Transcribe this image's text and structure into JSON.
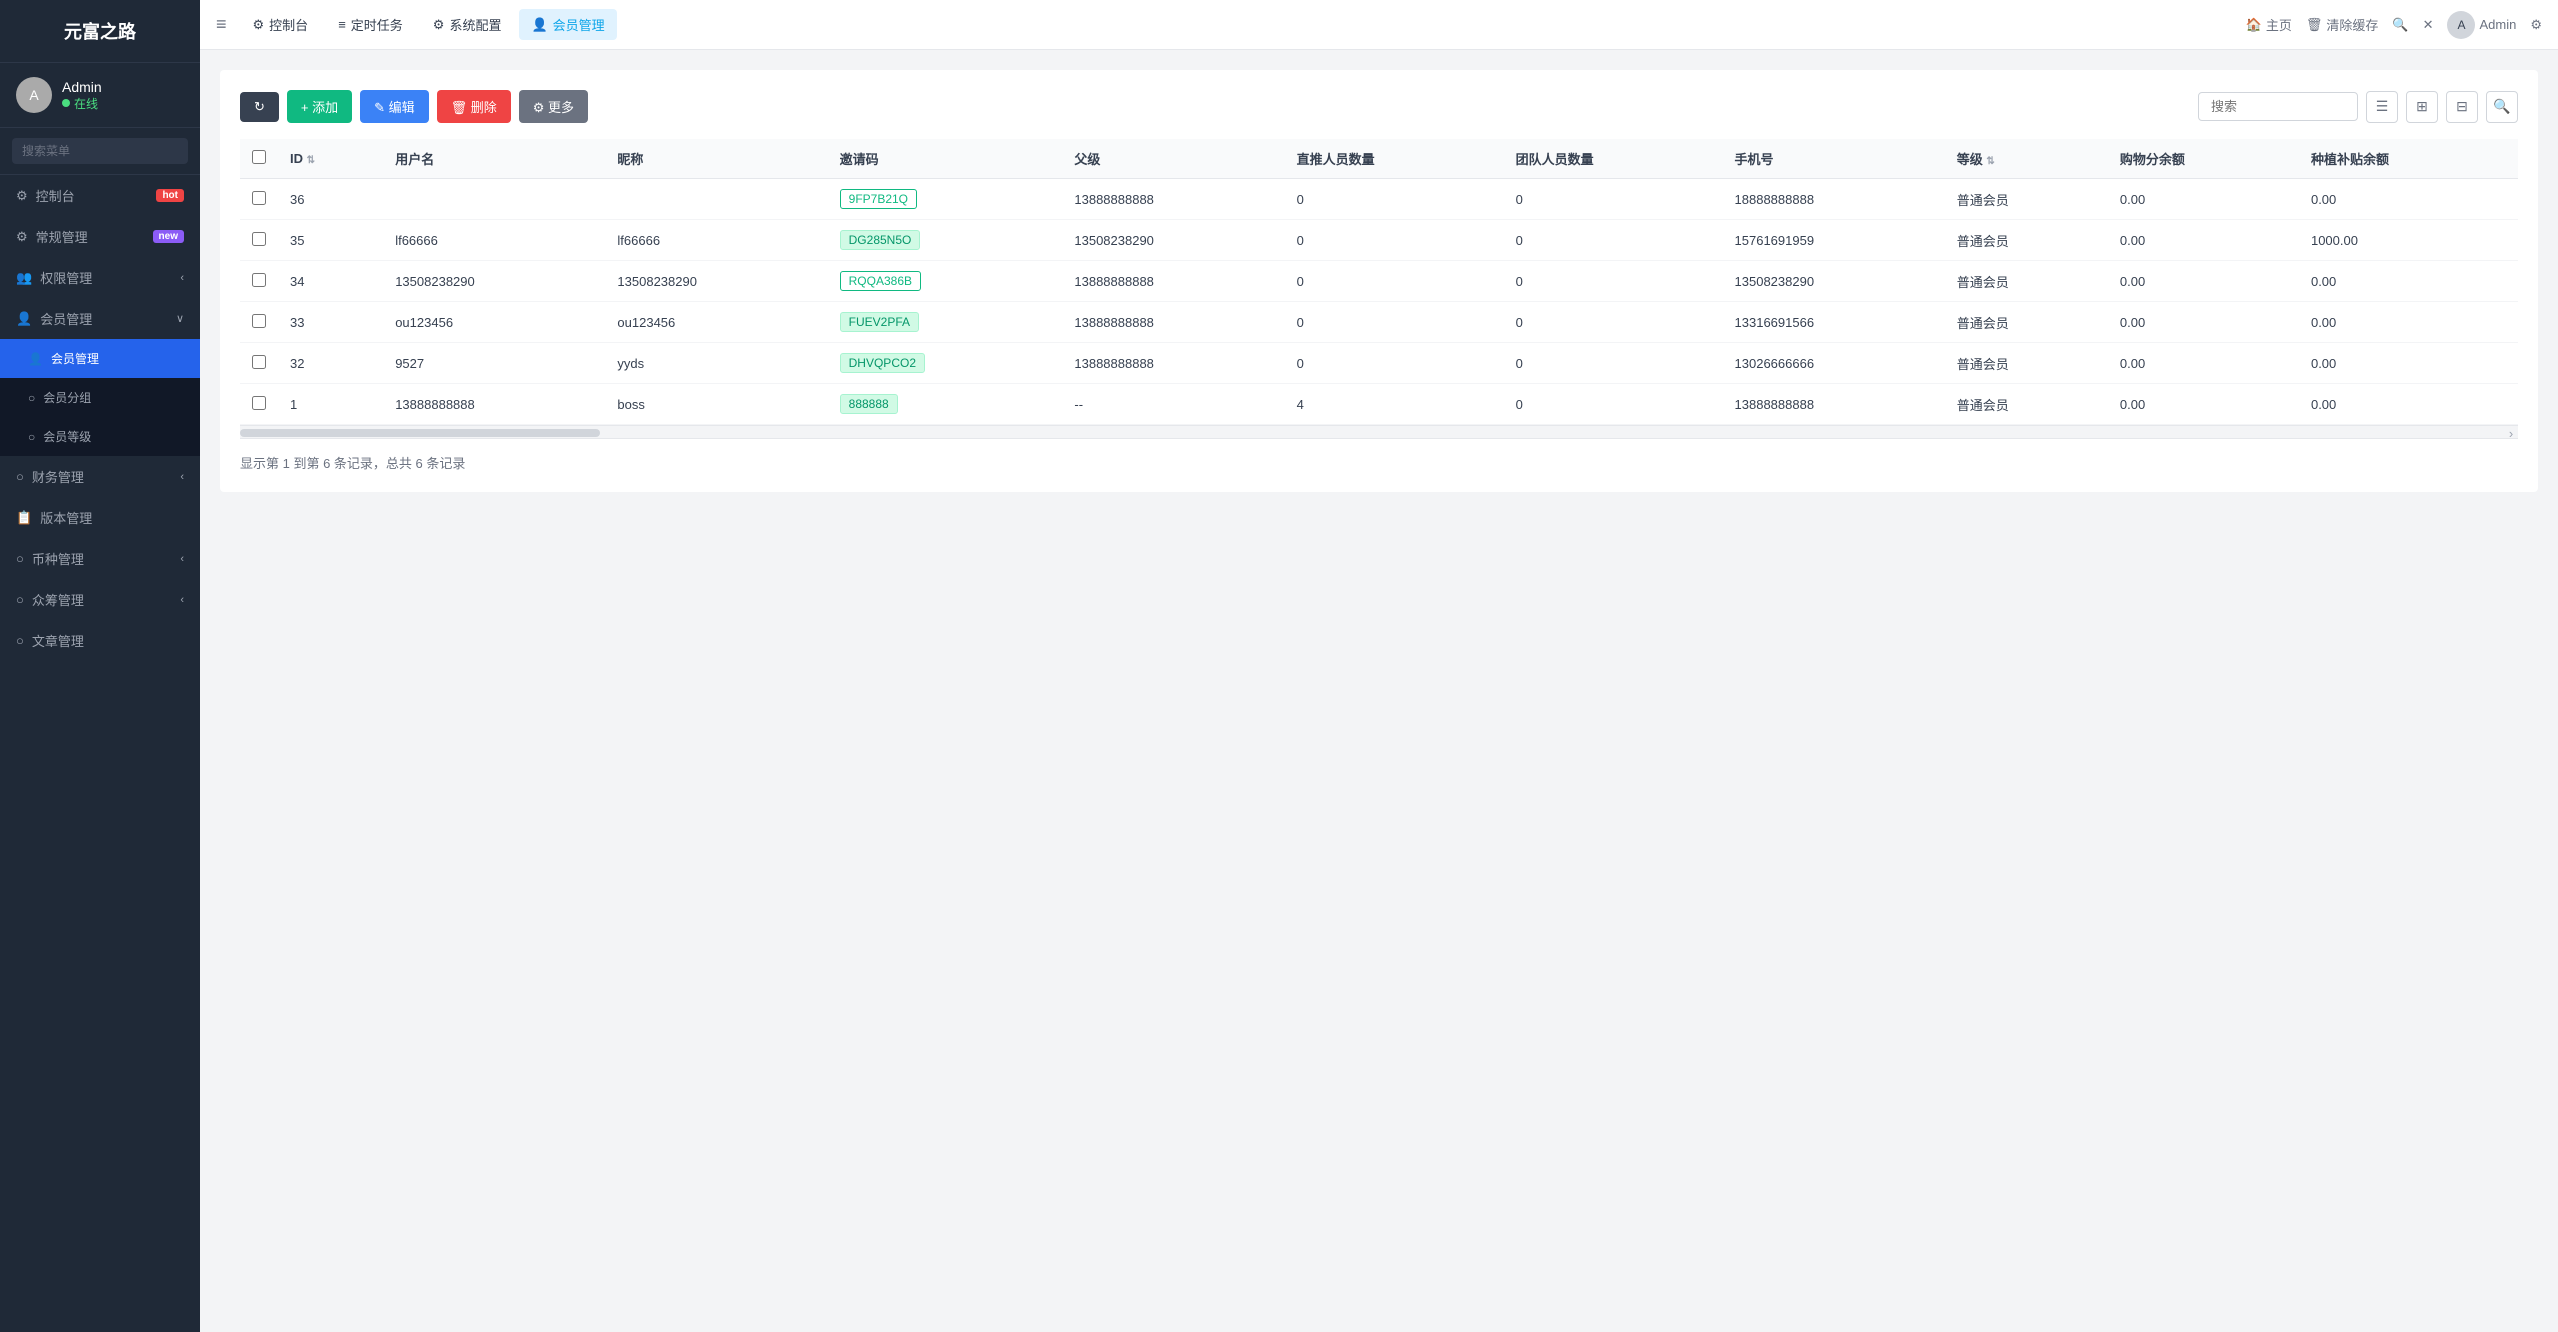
{
  "app": {
    "logo": "元富之路",
    "user": {
      "name": "Admin",
      "status": "在线"
    },
    "search_placeholder": "搜索菜单"
  },
  "sidebar": {
    "items": [
      {
        "id": "dashboard",
        "label": "控制台",
        "badge": "hot",
        "badge_text": "hot",
        "icon": "⚙"
      },
      {
        "id": "general",
        "label": "常规管理",
        "badge": "new",
        "badge_text": "new",
        "icon": "⚙"
      },
      {
        "id": "permission",
        "label": "权限管理",
        "arrow": "‹",
        "icon": "👥"
      },
      {
        "id": "member",
        "label": "会员管理",
        "arrow": "∨",
        "icon": "👤",
        "active_parent": true
      },
      {
        "id": "member-manage",
        "label": "会员管理",
        "sub": true,
        "active": true
      },
      {
        "id": "member-group",
        "label": "会员分组",
        "sub": true
      },
      {
        "id": "member-level",
        "label": "会员等级",
        "sub": true
      },
      {
        "id": "finance",
        "label": "财务管理",
        "arrow": "‹",
        "icon": "○"
      },
      {
        "id": "version",
        "label": "版本管理",
        "icon": "📋"
      },
      {
        "id": "currency",
        "label": "币种管理",
        "arrow": "‹",
        "icon": "○"
      },
      {
        "id": "crowdfund",
        "label": "众筹管理",
        "arrow": "‹",
        "icon": "○"
      },
      {
        "id": "article",
        "label": "文章管理",
        "icon": "○"
      }
    ]
  },
  "topnav": {
    "menu_icon": "≡",
    "tabs": [
      {
        "id": "dashboard",
        "label": "控制台",
        "icon": "⚙"
      },
      {
        "id": "scheduled",
        "label": "定时任务",
        "icon": "≡"
      },
      {
        "id": "sysconfig",
        "label": "系统配置",
        "icon": "⚙"
      },
      {
        "id": "member",
        "label": "会员管理",
        "icon": "👤",
        "active": true
      }
    ],
    "right": {
      "home": "主页",
      "clear_cache": "清除缓存",
      "icon1": "🔍",
      "icon2": "✕",
      "username": "Admin"
    }
  },
  "toolbar": {
    "refresh_label": "↻",
    "add_label": "+ 添加",
    "edit_label": "✎ 编辑",
    "delete_label": "🗑 删除",
    "more_label": "⚙ 更多",
    "search_placeholder": "搜索"
  },
  "table": {
    "columns": [
      {
        "key": "checkbox",
        "label": ""
      },
      {
        "key": "id",
        "label": "ID",
        "sortable": true
      },
      {
        "key": "username",
        "label": "用户名"
      },
      {
        "key": "nickname",
        "label": "昵称"
      },
      {
        "key": "invite_code",
        "label": "邀请码"
      },
      {
        "key": "parent",
        "label": "父级"
      },
      {
        "key": "direct_count",
        "label": "直推人员数量"
      },
      {
        "key": "team_count",
        "label": "团队人员数量"
      },
      {
        "key": "phone",
        "label": "手机号"
      },
      {
        "key": "level",
        "label": "等级",
        "sortable": true
      },
      {
        "key": "shopping_balance",
        "label": "购物分余额"
      },
      {
        "key": "plant_subsidy",
        "label": "种植补贴余额"
      }
    ],
    "rows": [
      {
        "id": "36",
        "username": "",
        "nickname": "",
        "invite_code": "9FP7B21Q",
        "invite_style": "green-outline",
        "parent": "13888888888",
        "direct_count": "0",
        "team_count": "0",
        "phone": "18888888888",
        "level": "普通会员",
        "shopping_balance": "0.00",
        "plant_subsidy": "0.00"
      },
      {
        "id": "35",
        "username": "lf66666",
        "nickname": "lf66666",
        "invite_code": "DG285N5O",
        "invite_style": "green-fill",
        "parent": "13508238290",
        "direct_count": "0",
        "team_count": "0",
        "phone": "15761691959",
        "level": "普通会员",
        "shopping_balance": "0.00",
        "plant_subsidy": "1000.00"
      },
      {
        "id": "34",
        "username": "13508238290",
        "nickname": "13508238290",
        "invite_code": "RQQA386B",
        "invite_style": "green-outline",
        "parent": "13888888888",
        "direct_count": "0",
        "team_count": "0",
        "phone": "13508238290",
        "level": "普通会员",
        "shopping_balance": "0.00",
        "plant_subsidy": "0.00"
      },
      {
        "id": "33",
        "username": "ou123456",
        "nickname": "ou123456",
        "invite_code": "FUEV2PFA",
        "invite_style": "green-fill",
        "parent": "13888888888",
        "direct_count": "0",
        "team_count": "0",
        "phone": "13316691566",
        "level": "普通会员",
        "shopping_balance": "0.00",
        "plant_subsidy": "0.00"
      },
      {
        "id": "32",
        "username": "9527",
        "nickname": "yyds",
        "invite_code": "DHVQPCO2",
        "invite_style": "green-fill",
        "parent": "13888888888",
        "direct_count": "0",
        "team_count": "0",
        "phone": "13026666666",
        "level": "普通会员",
        "shopping_balance": "0.00",
        "plant_subsidy": "0.00"
      },
      {
        "id": "1",
        "username": "13888888888",
        "nickname": "boss",
        "invite_code": "888888",
        "invite_style": "green-fill",
        "parent": "--",
        "direct_count": "4",
        "team_count": "0",
        "phone": "13888888888",
        "level": "普通会员",
        "shopping_balance": "0.00",
        "plant_subsidy": "0.00"
      }
    ]
  },
  "pagination": {
    "text": "显示第 1 到第 6 条记录，总共 6 条记录"
  }
}
